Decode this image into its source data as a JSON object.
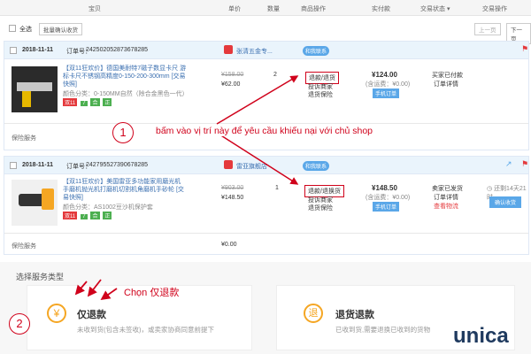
{
  "header": {
    "cols": [
      "宝贝",
      "单价",
      "数量",
      "商品操作",
      "实付款",
      "交易状态 ▾",
      "交易操作"
    ]
  },
  "toolbar": {
    "select_all": "全选",
    "batch_confirm": "批量确认收货",
    "prev_page": "上一页",
    "next_page": "下一页"
  },
  "orders": [
    {
      "date": "2018-11-11",
      "order_no_label": "订单号：",
      "order_no": "242502052873678285",
      "shop": "张清五金专...",
      "contact": "和我联系",
      "title": "【双11狂欢价】德国美耐特7磁子数显卡尺 游标卡尺不锈钢高精度0-150-200-300mm [交易快照]",
      "spec": "颜色分类：0-150MM自然（除合金黑色一代）",
      "tags": [
        "双11",
        "7",
        "合",
        "正"
      ],
      "orig_price": "¥158.00",
      "price": "¥62.00",
      "qty": "2",
      "op_link": "退款/退货",
      "op_complain": "投诉商家",
      "op_warranty": "退货保险",
      "paid": "¥124.00",
      "shipping": "(含运费：¥0.00)",
      "pay_badge": "手机订单",
      "status1": "买家已付款",
      "status2": "订单详情",
      "service": "保险服务"
    },
    {
      "date": "2018-11-11",
      "order_no_label": "订单号：",
      "order_no": "242795527390678285",
      "shop": "雷亚旗舰店",
      "contact": "和我联系",
      "title": "【双11狂欢价】美国雷亚多功能家用磨光机手磨机抛光机打磨机切割机角磨机手砂轮 [交易快照]",
      "spec": "颜色分类：AS1002豆沙机保护套",
      "tags": [
        "双11",
        "7",
        "合",
        "正"
      ],
      "orig_price": "¥903.00",
      "price": "¥148.50",
      "qty": "1",
      "op_link": "退款/退换货",
      "op_complain": "投诉商家",
      "op_warranty": "退货保险",
      "paid": "¥148.50",
      "shipping": "(含运费：¥0.00)",
      "pay_badge": "手机订单",
      "status1": "卖家已发货",
      "status2": "订单详情",
      "status3": "查看物流",
      "remain": "还剩14天21时",
      "confirm": "确认收货",
      "service": "保险服务",
      "service_price": "¥0.00"
    }
  ],
  "service_section": {
    "title": "选择服务类型",
    "option1_label": "仅退款",
    "option1_desc": "未收到货(包含未签收)，或卖家协商同意前提下",
    "option1_icon": "¥",
    "option2_label": "退货退款",
    "option2_desc": "已收到货,需要退换已收到的货物",
    "option2_icon": "退"
  },
  "annotations": {
    "step1": "1",
    "step1_text": "bấm vào vị trí này để yêu cầu khiếu nại với chủ shop",
    "step2": "2",
    "step2_text": "Chọn 仅退款"
  },
  "watermark": "unica",
  "colors": {
    "annotation": "#d0021b",
    "accent_blue": "#5aa7e8"
  }
}
